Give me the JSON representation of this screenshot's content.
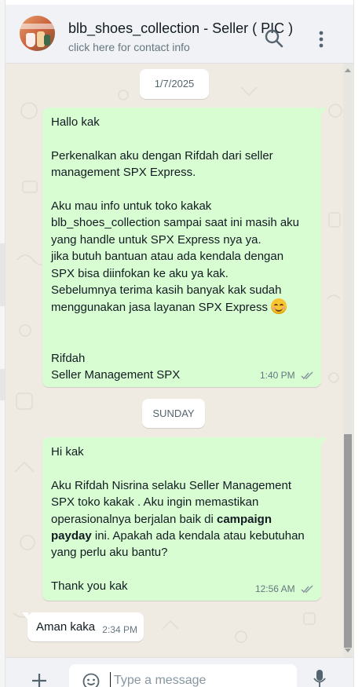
{
  "header": {
    "contact_name": "blb_shoes_collection - Seller ( PIC )",
    "subtitle": "click here for contact info",
    "icons": [
      "avatar-image",
      "search-icon",
      "menu-dots-icon"
    ]
  },
  "messages": [
    {
      "type": "date",
      "label": "1/7/2025"
    },
    {
      "type": "outgoing",
      "lines": [
        "Hallo kak",
        "",
        "Perkenalkan aku dengan Rifdah dari seller",
        "management SPX Express.",
        "",
        "Aku mau info untuk toko kakak",
        "blb_shoes_collection sampai saat ini masih aku",
        "yang handle untuk SPX Express nya ya.",
        "jika butuh bantuan atau ada kendala dengan",
        "SPX bisa diinfokan ke aku ya kak.",
        "Sebelumnya terima kasih banyak kak sudah",
        "menggunakan jasa layanan SPX Express 😊",
        "",
        "",
        "Rifdah",
        "Seller Management SPX"
      ],
      "time": "1:40 PM",
      "status_icon": "double-check-icon"
    },
    {
      "type": "date",
      "label": "SUNDAY"
    },
    {
      "type": "outgoing",
      "lines": [
        "Hi kak",
        "",
        "Aku Rifdah Nisrina selaku Seller Management",
        "SPX toko kakak . Aku ingin memastikan",
        "operasionalnya berjalan baik di campaign",
        "payday ini. Apakah ada kendala atau kebutuhan",
        "yang perlu aku bantu?",
        "",
        "Thank you kak"
      ],
      "bold_phrase": "campaign payday",
      "time": "12:56 AM",
      "status_icon": "double-check-icon"
    },
    {
      "type": "incoming",
      "text": "Aman kaka",
      "time": "2:34 PM"
    }
  ],
  "composer": {
    "placeholder": "Type a message",
    "icons": [
      "plus-icon",
      "emoji-icon",
      "mic-icon"
    ]
  },
  "colors": {
    "header_bg": "#f0f2f5",
    "chat_bg": "#efeae2",
    "outgoing_bubble": "#d9fdd3",
    "incoming_bubble": "#ffffff",
    "meta_text": "#667781",
    "read_ticks": "#8696a0"
  }
}
